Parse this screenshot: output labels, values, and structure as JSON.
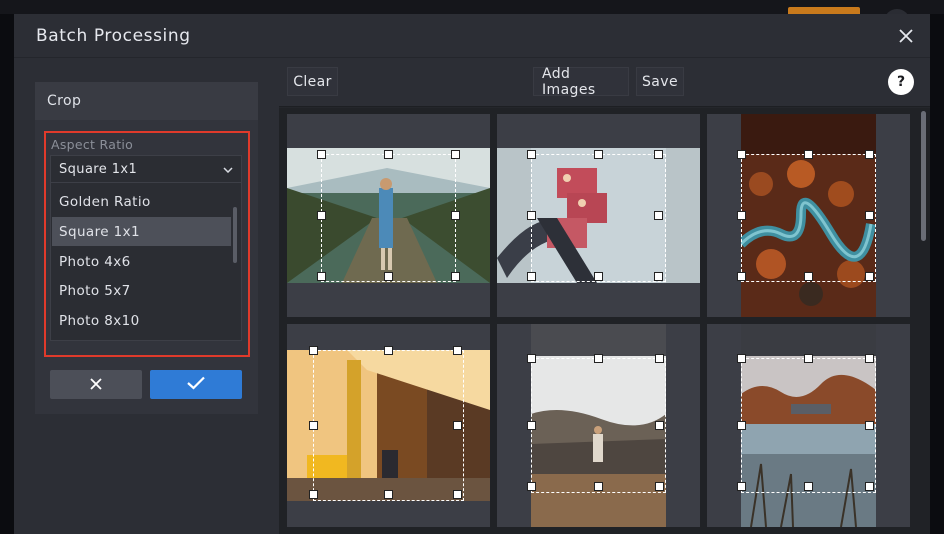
{
  "dialog": {
    "title": "Batch Processing"
  },
  "crop": {
    "title": "Crop",
    "aspect_label": "Aspect Ratio",
    "selected": "Square 1x1",
    "options": [
      "Golden Ratio",
      "Square 1x1",
      "Photo 4x6",
      "Photo 5x7",
      "Photo 8x10"
    ]
  },
  "toolbar": {
    "clear": "Clear",
    "add_images": "Add Images",
    "save": "Save",
    "help": "?"
  },
  "colors": {
    "accent": "#2f7bd6",
    "highlight": "#e03a2b"
  },
  "icons": {
    "close": "close-icon",
    "cancel": "x-icon",
    "confirm": "checkmark-icon",
    "chevron": "chevron-down-icon"
  }
}
